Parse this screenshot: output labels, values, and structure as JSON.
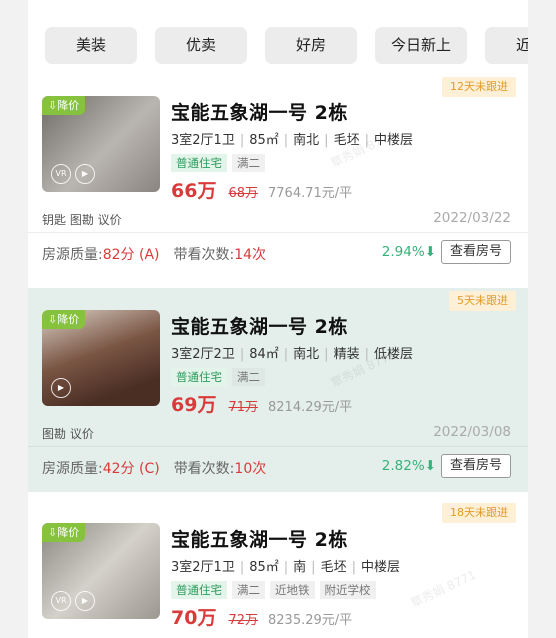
{
  "filters": [
    "美装",
    "优卖",
    "好房",
    "今日新上",
    "近期"
  ],
  "listings": [
    {
      "title": "宝能五象湖一号 2栋",
      "follow_tag": "12天未跟进",
      "price_drop_tag": "降价",
      "specs": [
        "3室2厅1卫",
        "85㎡",
        "南北",
        "毛坯",
        "中楼层"
      ],
      "tags": [
        "普通住宅",
        "满二"
      ],
      "price": "66万",
      "old_price": "68万",
      "unit_price": "7764.71元/平",
      "keywords": "钥匙 图勘 议价",
      "date": "2022/03/22",
      "quality_label": "房源质量:",
      "quality_value": "82分 (A)",
      "views_label": "带看次数:",
      "views_value": "14次",
      "growth": "2.94%",
      "button": "查看房号",
      "thumb_colors": [
        "#6e6a66",
        "#b9b5b0"
      ],
      "has_vr": true
    },
    {
      "title": "宝能五象湖一号 2栋",
      "follow_tag": "5天未跟进",
      "price_drop_tag": "降价",
      "specs": [
        "3室2厅2卫",
        "84㎡",
        "南北",
        "精装",
        "低楼层"
      ],
      "tags": [
        "普通住宅",
        "满二"
      ],
      "price": "69万",
      "old_price": "71万",
      "unit_price": "8214.29元/平",
      "keywords": "图勘 议价",
      "date": "2022/03/08",
      "quality_label": "房源质量:",
      "quality_value": "42分 (C)",
      "views_label": "带看次数:",
      "views_value": "10次",
      "growth": "2.82%",
      "button": "查看房号",
      "thumb_colors": [
        "#5a3a2c",
        "#c8a58a"
      ],
      "has_vr": false
    },
    {
      "title": "宝能五象湖一号 2栋",
      "follow_tag": "18天未跟进",
      "price_drop_tag": "降价",
      "specs": [
        "3室2厅1卫",
        "85㎡",
        "南",
        "毛坯",
        "中楼层"
      ],
      "tags": [
        "普通住宅",
        "满二",
        "近地铁",
        "附近学校"
      ],
      "price": "70万",
      "old_price": "72万",
      "unit_price": "8235.29元/平",
      "thumb_colors": [
        "#8a8680",
        "#d4d0ca"
      ],
      "has_vr": true
    }
  ],
  "watermark": "覃秀娟 8771"
}
